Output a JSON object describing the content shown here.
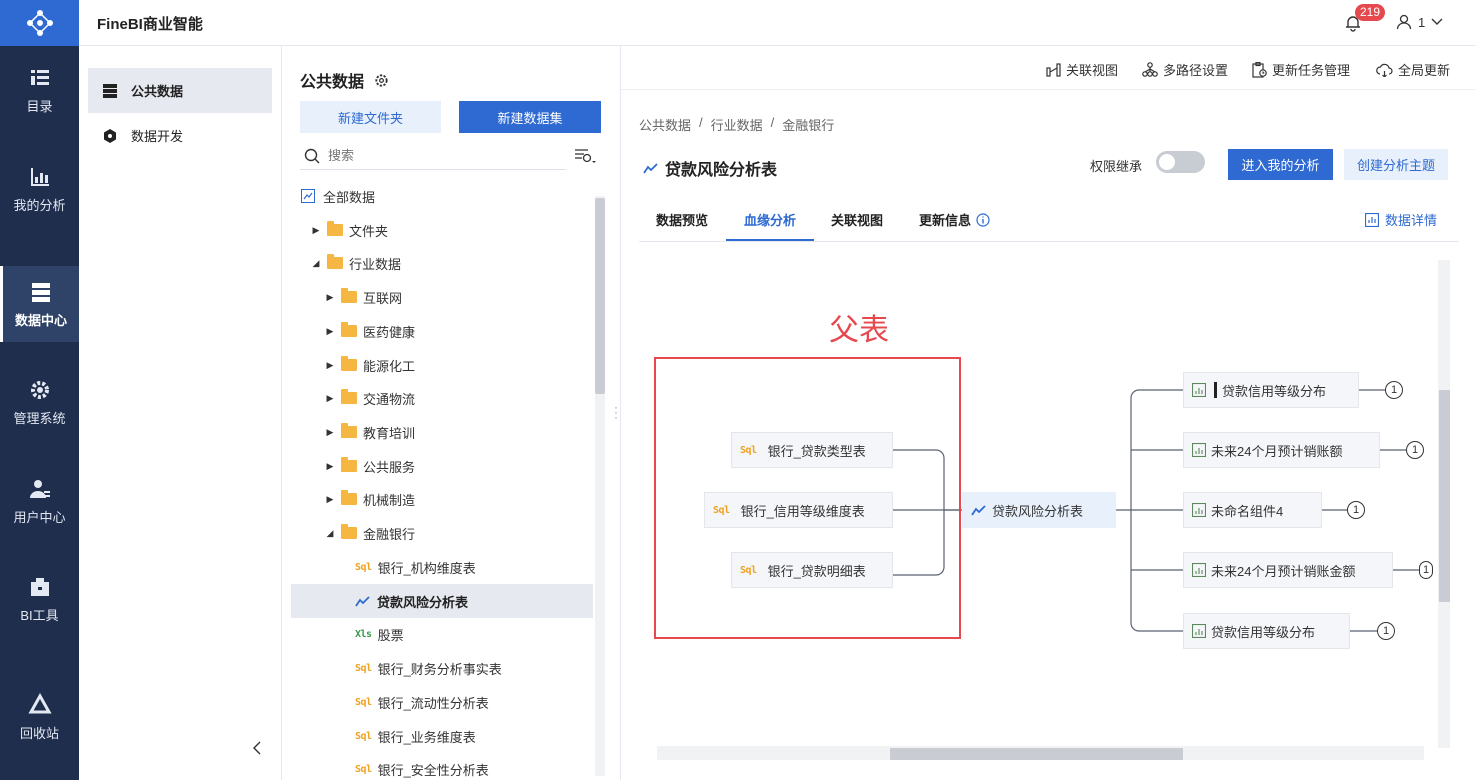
{
  "app": {
    "title": "FineBI商业智能",
    "notif_count": "219",
    "user": "1"
  },
  "leftnav": {
    "items": [
      {
        "label": "目录",
        "icon": "catalog-icon"
      },
      {
        "label": "我的分析",
        "icon": "analysis-icon"
      },
      {
        "label": "数据中心",
        "icon": "data-center-icon"
      },
      {
        "label": "管理系统",
        "icon": "gear-icon"
      },
      {
        "label": "用户中心",
        "icon": "user-center-icon"
      },
      {
        "label": "BI工具",
        "icon": "toolbox-icon"
      },
      {
        "label": "回收站",
        "icon": "recycle-icon"
      }
    ]
  },
  "panel2": {
    "items": [
      {
        "label": "公共数据"
      },
      {
        "label": "数据开发"
      }
    ]
  },
  "panel3": {
    "title": "公共数据",
    "new_folder": "新建文件夹",
    "new_dataset": "新建数据集",
    "search_placeholder": "搜索",
    "tree": [
      {
        "label": "全部数据"
      },
      {
        "label": "文件夹"
      },
      {
        "label": "行业数据"
      },
      {
        "label": "互联网"
      },
      {
        "label": "医药健康"
      },
      {
        "label": "能源化工"
      },
      {
        "label": "交通物流"
      },
      {
        "label": "教育培训"
      },
      {
        "label": "公共服务"
      },
      {
        "label": "机械制造"
      },
      {
        "label": "金融银行"
      },
      {
        "label": "银行_机构维度表"
      },
      {
        "label": "贷款风险分析表"
      },
      {
        "label": "股票"
      },
      {
        "label": "银行_财务分析事实表"
      },
      {
        "label": "银行_流动性分析表"
      },
      {
        "label": "银行_业务维度表"
      },
      {
        "label": "银行_安全性分析表"
      }
    ]
  },
  "toolbar": {
    "relation_view": "关联视图",
    "multipath": "多路径设置",
    "update_task": "更新任务管理",
    "global_update": "全局更新"
  },
  "breadcrumb": [
    "公共数据",
    "/",
    "行业数据",
    "/",
    "金融银行"
  ],
  "page": {
    "title": "贷款风险分析表",
    "perm_label": "权限继承",
    "enter_btn": "进入我的分析",
    "create_btn": "创建分析主题"
  },
  "tabs": {
    "preview": "数据预览",
    "lineage": "血缘分析",
    "relation": "关联视图",
    "update_info": "更新信息",
    "data_detail": "数据详情"
  },
  "lineage": {
    "annotation": "父表",
    "parents": [
      "银行_贷款类型表",
      "银行_信用等级维度表",
      "银行_贷款明细表"
    ],
    "center": "贷款风险分析表",
    "children": [
      {
        "label": "贷款信用等级分布",
        "count": "1"
      },
      {
        "label": "未来24个月预计销账额",
        "count": "1"
      },
      {
        "label": "未命名组件4",
        "count": "1"
      },
      {
        "label": "未来24个月预计销账金额",
        "count": "1"
      },
      {
        "label": "贷款信用等级分布",
        "count": "1"
      }
    ]
  }
}
